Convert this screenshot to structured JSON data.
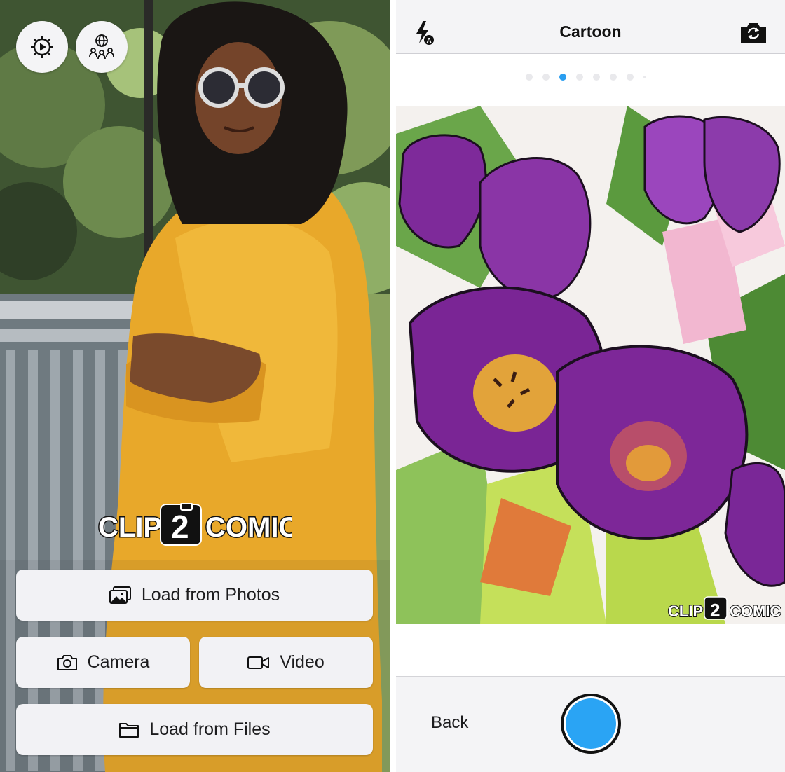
{
  "left_screen": {
    "logo": {
      "left": "CLIP",
      "middle": "2",
      "right": "COMIC"
    },
    "buttons": {
      "load_photos": "Load from Photos",
      "camera": "Camera",
      "video": "Video",
      "load_files": "Load from Files"
    },
    "icons": {
      "settings": "gear-play-icon",
      "community": "globe-people-icon"
    }
  },
  "right_screen": {
    "title": "Cartoon",
    "page_indicator": {
      "count": 8,
      "active_index": 2
    },
    "watermark": {
      "left": "CLIP",
      "middle": "2",
      "right": "COMIC"
    },
    "back_label": "Back",
    "icons": {
      "flash": "flash-auto-icon",
      "switch_camera": "camera-switch-icon",
      "shutter": "shutter-button"
    },
    "colors": {
      "accent": "#2aa4f4",
      "active_dot": "#2a9ef0"
    }
  }
}
